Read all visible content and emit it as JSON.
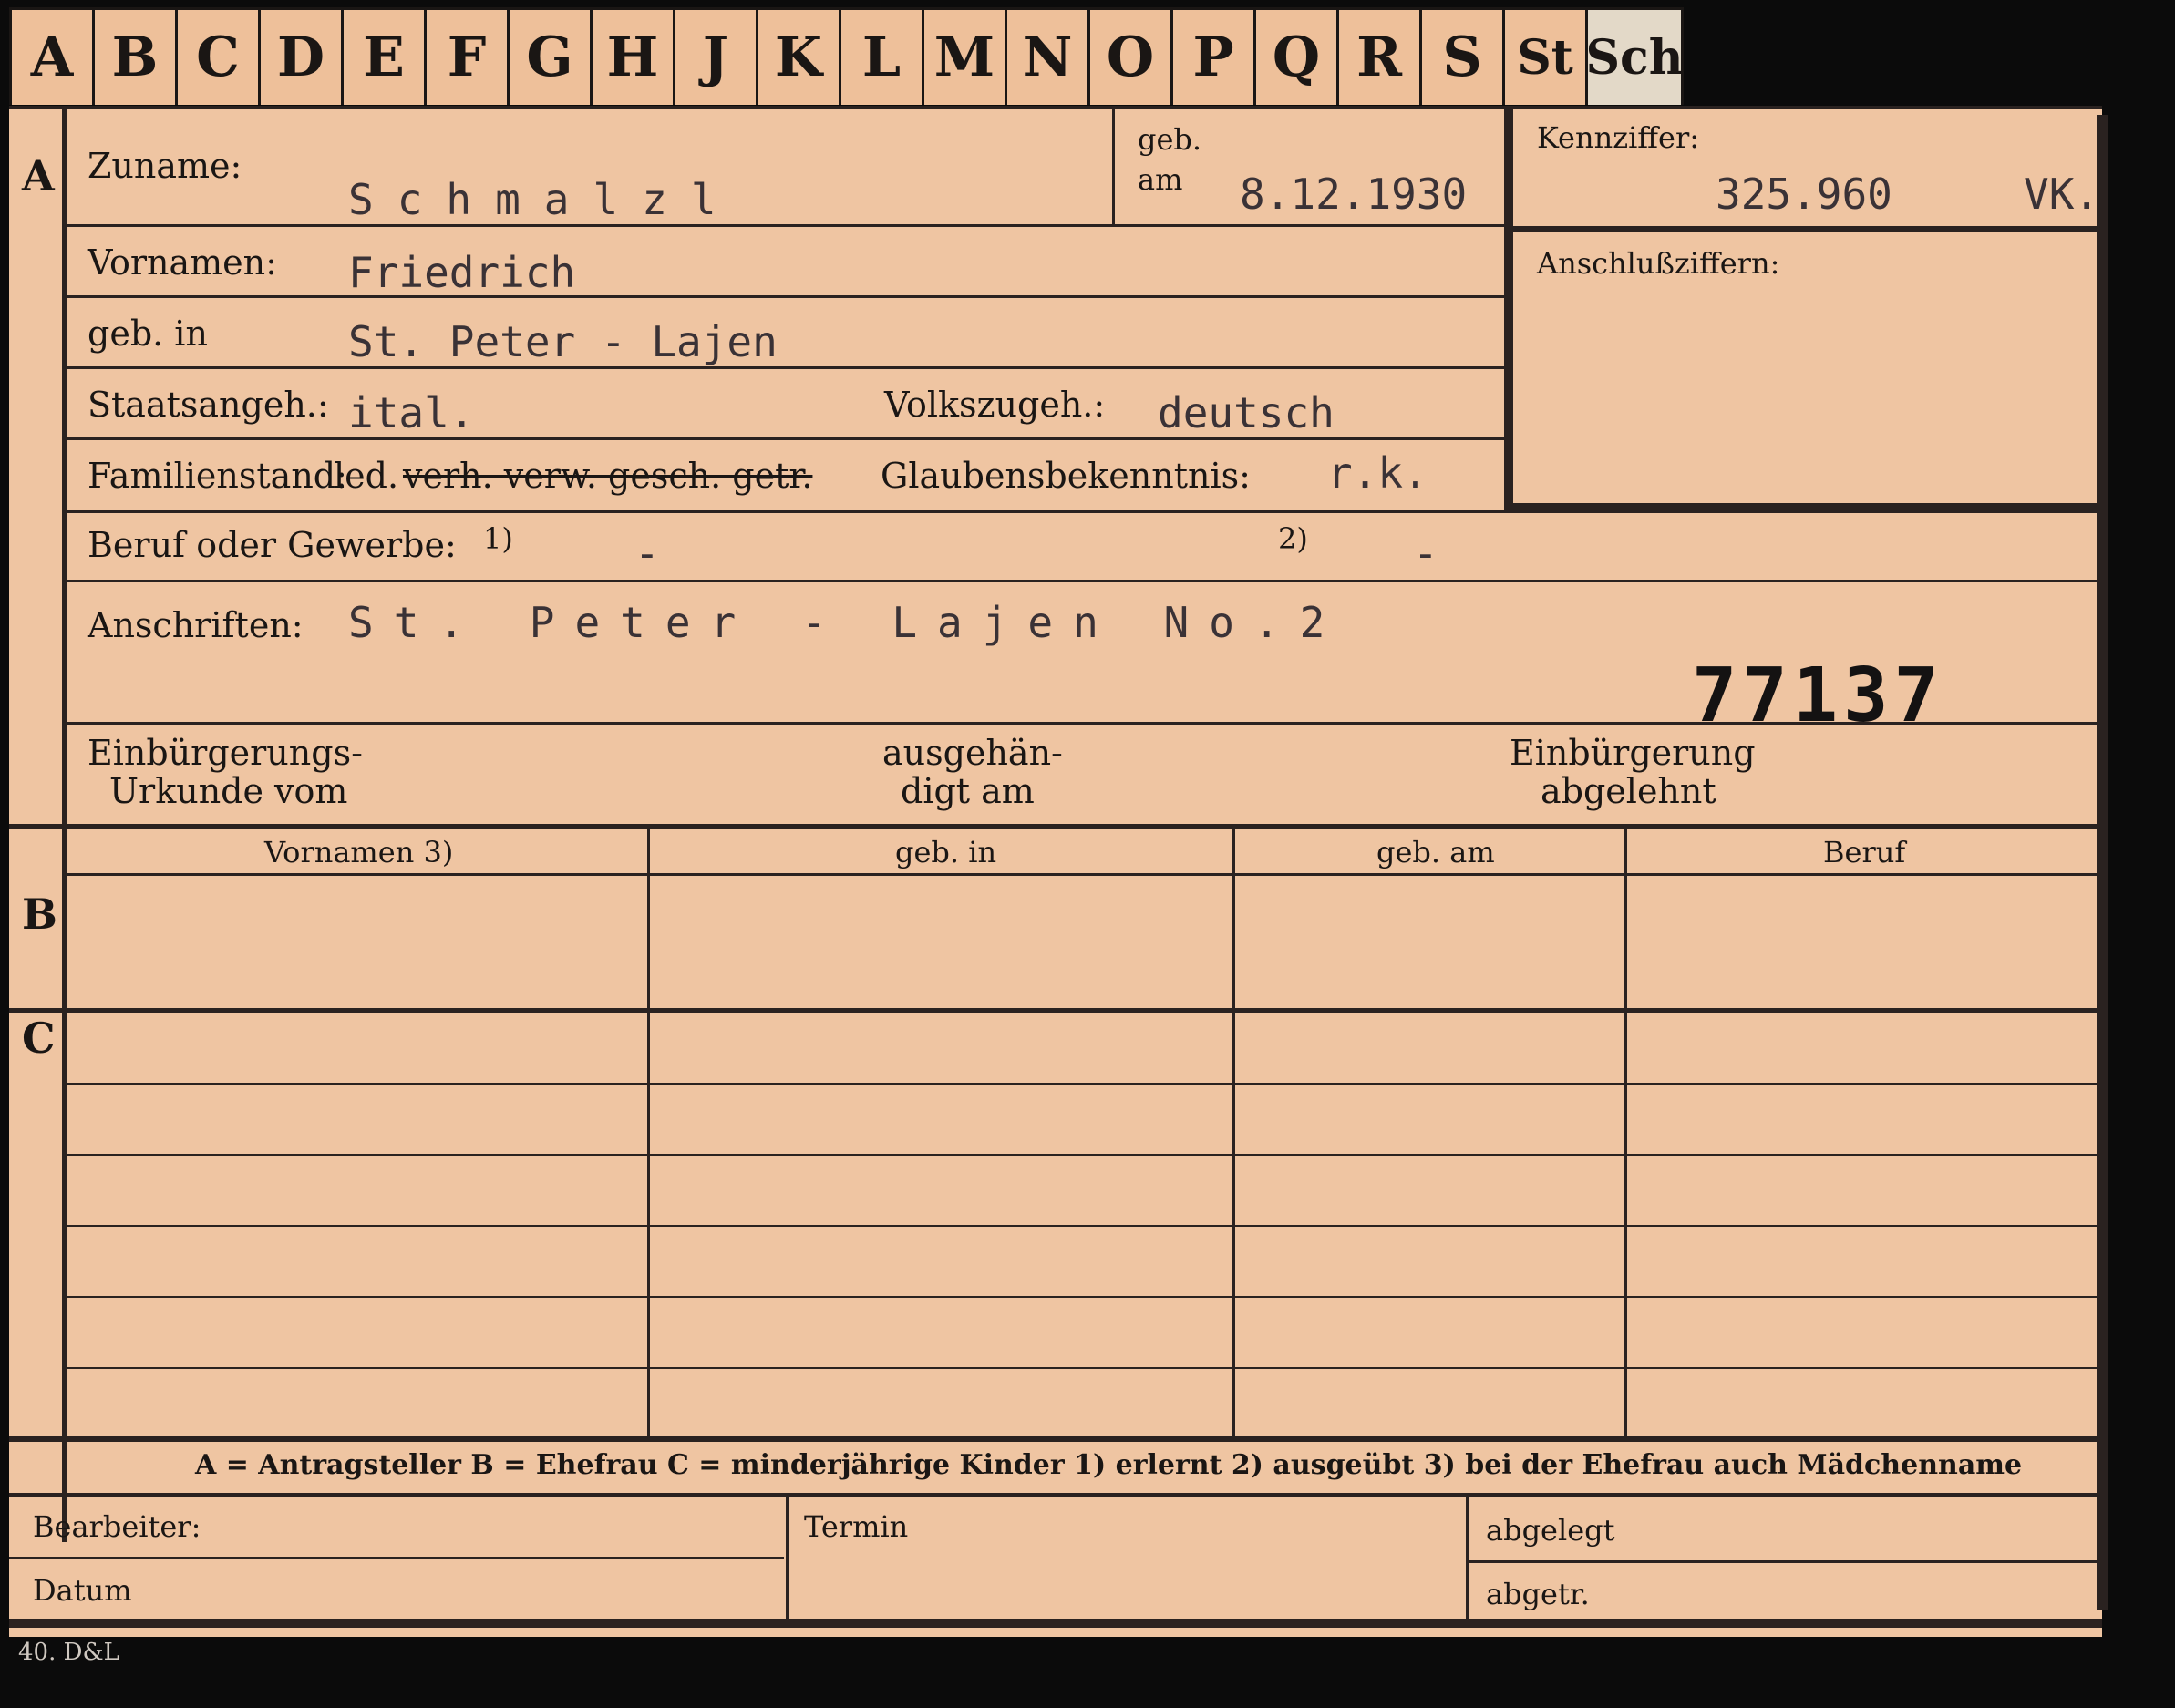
{
  "tabs": [
    "A",
    "B",
    "C",
    "D",
    "E",
    "F",
    "G",
    "H",
    "J",
    "K",
    "L",
    "M",
    "N",
    "O",
    "P",
    "Q",
    "R",
    "S",
    "St",
    "Sch"
  ],
  "sections": {
    "a": "A",
    "b": "B",
    "c": "C"
  },
  "labels": {
    "zuname": "Zuname:",
    "geb": "geb.",
    "am": "am",
    "kennziffer": "Kennziffer:",
    "anschlussziffern": "Anschlußziffern:",
    "vornamen": "Vornamen:",
    "geb_in": "geb. in",
    "staatsangeh": "Staatsangeh.:",
    "volkszugeh": "Volkszugeh.:",
    "familienstand": "Familienstand:",
    "fam_options_plain": "led.",
    "fam_options_struck": "verh. verw. gesch. getr.",
    "glaubensbekenntnis": "Glaubensbekenntnis:",
    "beruf": "Beruf oder Gewerbe:",
    "note1": "1)",
    "note2": "2)",
    "anschriften": "Anschriften:",
    "einbuergerungs_1": "Einbürgerungs-",
    "einbuergerungs_2": "Urkunde vom",
    "ausgehaen_1": "ausgehän-",
    "ausgehaen_2": "digt am",
    "einbuergerung_1": "Einbürgerung",
    "einbuergerung_2": "abgelehnt"
  },
  "values": {
    "zuname": "Schmalzl",
    "geb_am": "8.12.1930",
    "kennziffer": "325.960",
    "kennziffer_suffix": "VK.",
    "vornamen": "Friedrich",
    "geb_in": "St. Peter - Lajen",
    "staatsangeh": "ital.",
    "volkszugeh": "deutsch",
    "glaubensbekenntnis": "r.k.",
    "beruf_1": "-",
    "beruf_2": "-",
    "anschriften": "St. Peter - Lajen No.2",
    "stamp_number": "77137"
  },
  "table": {
    "headers": [
      "Vornamen 3)",
      "geb. in",
      "geb. am",
      "Beruf"
    ]
  },
  "legend": "A = Antragsteller   B = Ehefrau   C = minderjährige Kinder   1) erlernt   2) ausgeübt   3) bei der Ehefrau auch Mädchenname",
  "bottom": {
    "bearbeiter": "Bearbeiter:",
    "datum": "Datum",
    "termin": "Termin",
    "abgelegt": "abgelegt",
    "abgetr": "abgetr."
  },
  "footer": "40. D&L"
}
